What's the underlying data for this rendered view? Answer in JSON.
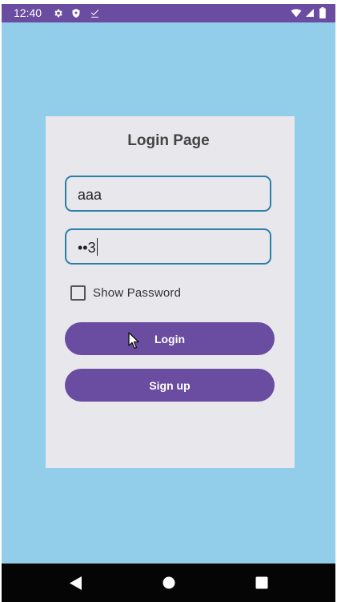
{
  "status_bar": {
    "time": "12:40",
    "left_icons": [
      "gear-icon",
      "shield-icon",
      "download-done-icon"
    ],
    "right_icons": [
      "wifi-icon",
      "signal-icon",
      "battery-icon"
    ]
  },
  "page": {
    "title": "Login Page"
  },
  "form": {
    "username_value": "aaa",
    "password_value": "••3",
    "show_password_label": "Show Password",
    "show_password_checked": false
  },
  "buttons": {
    "login_label": "Login",
    "signup_label": "Sign up"
  },
  "nav_bar": {
    "buttons": [
      "back-icon",
      "home-icon",
      "recents-icon"
    ]
  },
  "colors": {
    "status_bar": "#6a4ca0",
    "background": "#92cdea",
    "card": "#e8e7ec",
    "field_border": "#2d7fa8",
    "button": "#6a4ca0",
    "nav_bar": "#050505"
  }
}
